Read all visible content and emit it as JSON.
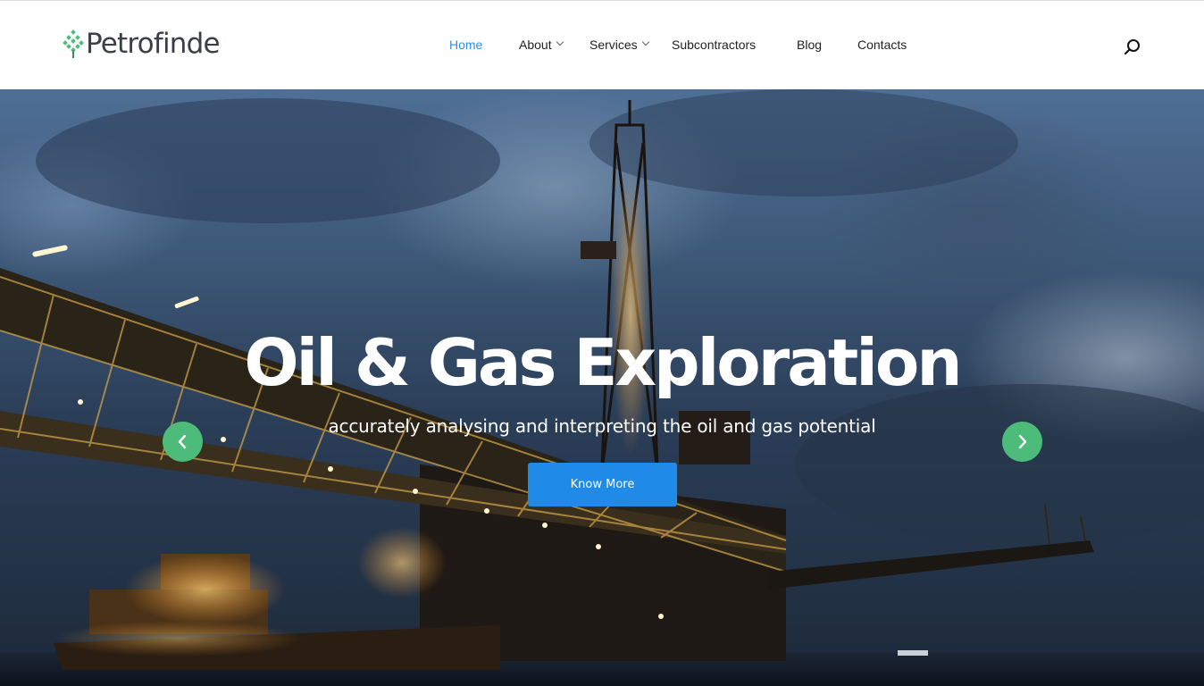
{
  "brand": {
    "name": "Petrofinde"
  },
  "nav": {
    "items": [
      {
        "label": "Home",
        "active": true
      },
      {
        "label": "About",
        "dropdown": true
      },
      {
        "label": "Services",
        "dropdown": true
      },
      {
        "label": "Subcontractors"
      },
      {
        "label": "Blog"
      },
      {
        "label": "Contacts"
      }
    ],
    "search_icon": "search-icon"
  },
  "hero": {
    "title": "Oil & Gas Exploration",
    "subtitle": "accurately analysing and interpreting the oil and gas potential",
    "cta_label": "Know More",
    "prev_icon": "chevron-left-icon",
    "next_icon": "chevron-right-icon"
  },
  "colors": {
    "accent": "#2f8fe6",
    "cta": "#1f8ae8",
    "arrow": "#4dbb7a",
    "logo_green": "#4dbb7a",
    "logo_text": "#3a3f47"
  }
}
